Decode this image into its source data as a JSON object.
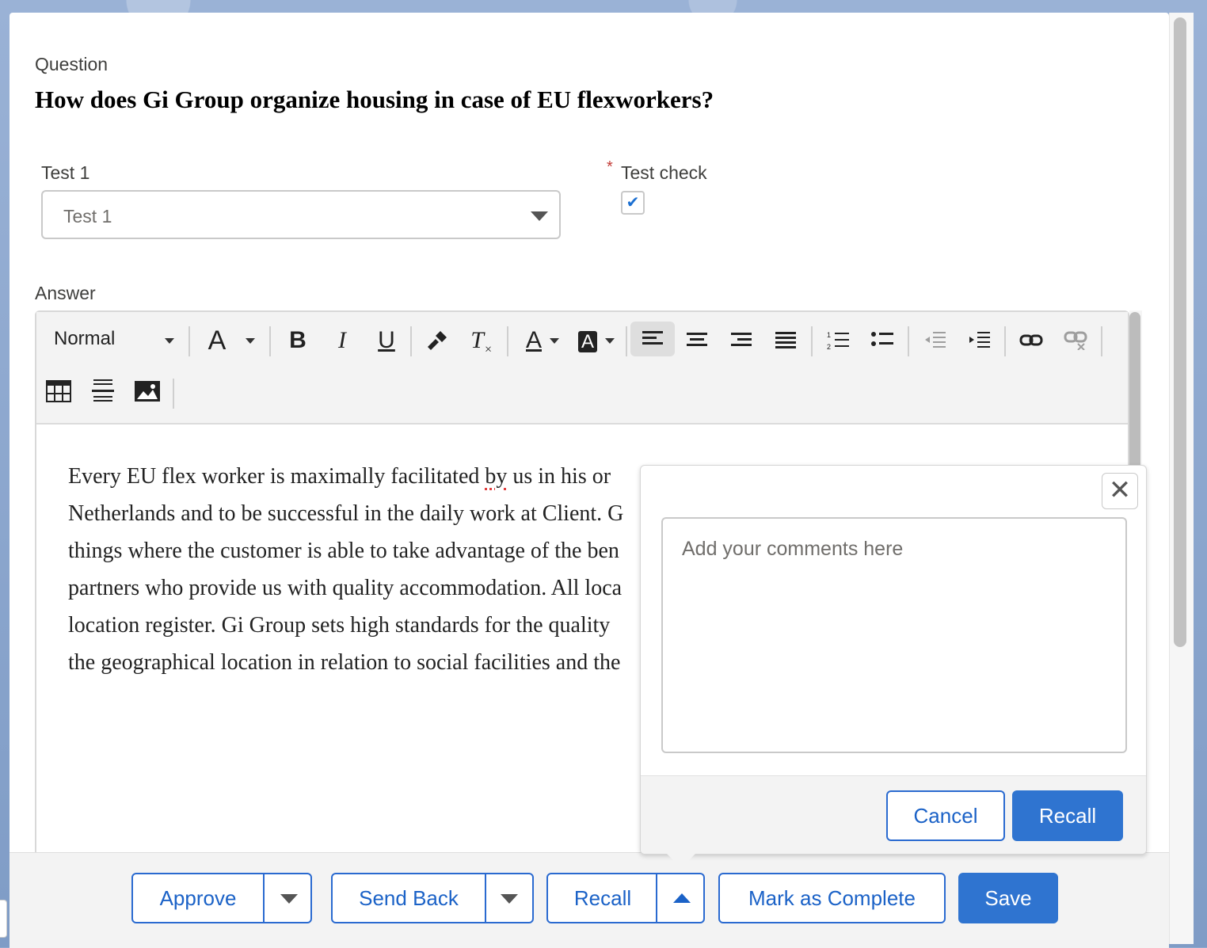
{
  "question": {
    "label": "Question",
    "title": "How does Gi Group organize housing in case of EU flexworkers?"
  },
  "fields": {
    "test1": {
      "label": "Test 1",
      "value": "Test 1"
    },
    "test_check": {
      "label": "Test check",
      "required_marker": "*",
      "checked": true,
      "check_glyph": "✔"
    }
  },
  "answer": {
    "label": "Answer",
    "lines": [
      "Every EU flex worker is maximally facilitated ",
      "Netherlands and to be successful in the daily work at Client. G",
      "things where the customer is able to take advantage of the ben",
      "partners who provide us with quality accommodation. All loca",
      "location register. Gi Group sets high standards for the quality",
      "the geographical location in relation to social facilities and the"
    ],
    "line1_spell": "by",
    "line1_rest": " us in his or"
  },
  "toolbar": {
    "format": "Normal",
    "font_size_glyph": "A",
    "bold": "B",
    "italic": "I",
    "underline": "U",
    "clear_format": "T",
    "text_color": "A",
    "bg_color": "A"
  },
  "popover": {
    "close_glyph": "✕",
    "placeholder": "Add your comments here",
    "cancel": "Cancel",
    "submit": "Recall"
  },
  "footer": {
    "approve": "Approve",
    "send_back": "Send Back",
    "recall": "Recall",
    "mark_complete": "Mark as Complete",
    "save": "Save"
  },
  "colors": {
    "brand": "#2f74d0",
    "required": "#c23934"
  }
}
